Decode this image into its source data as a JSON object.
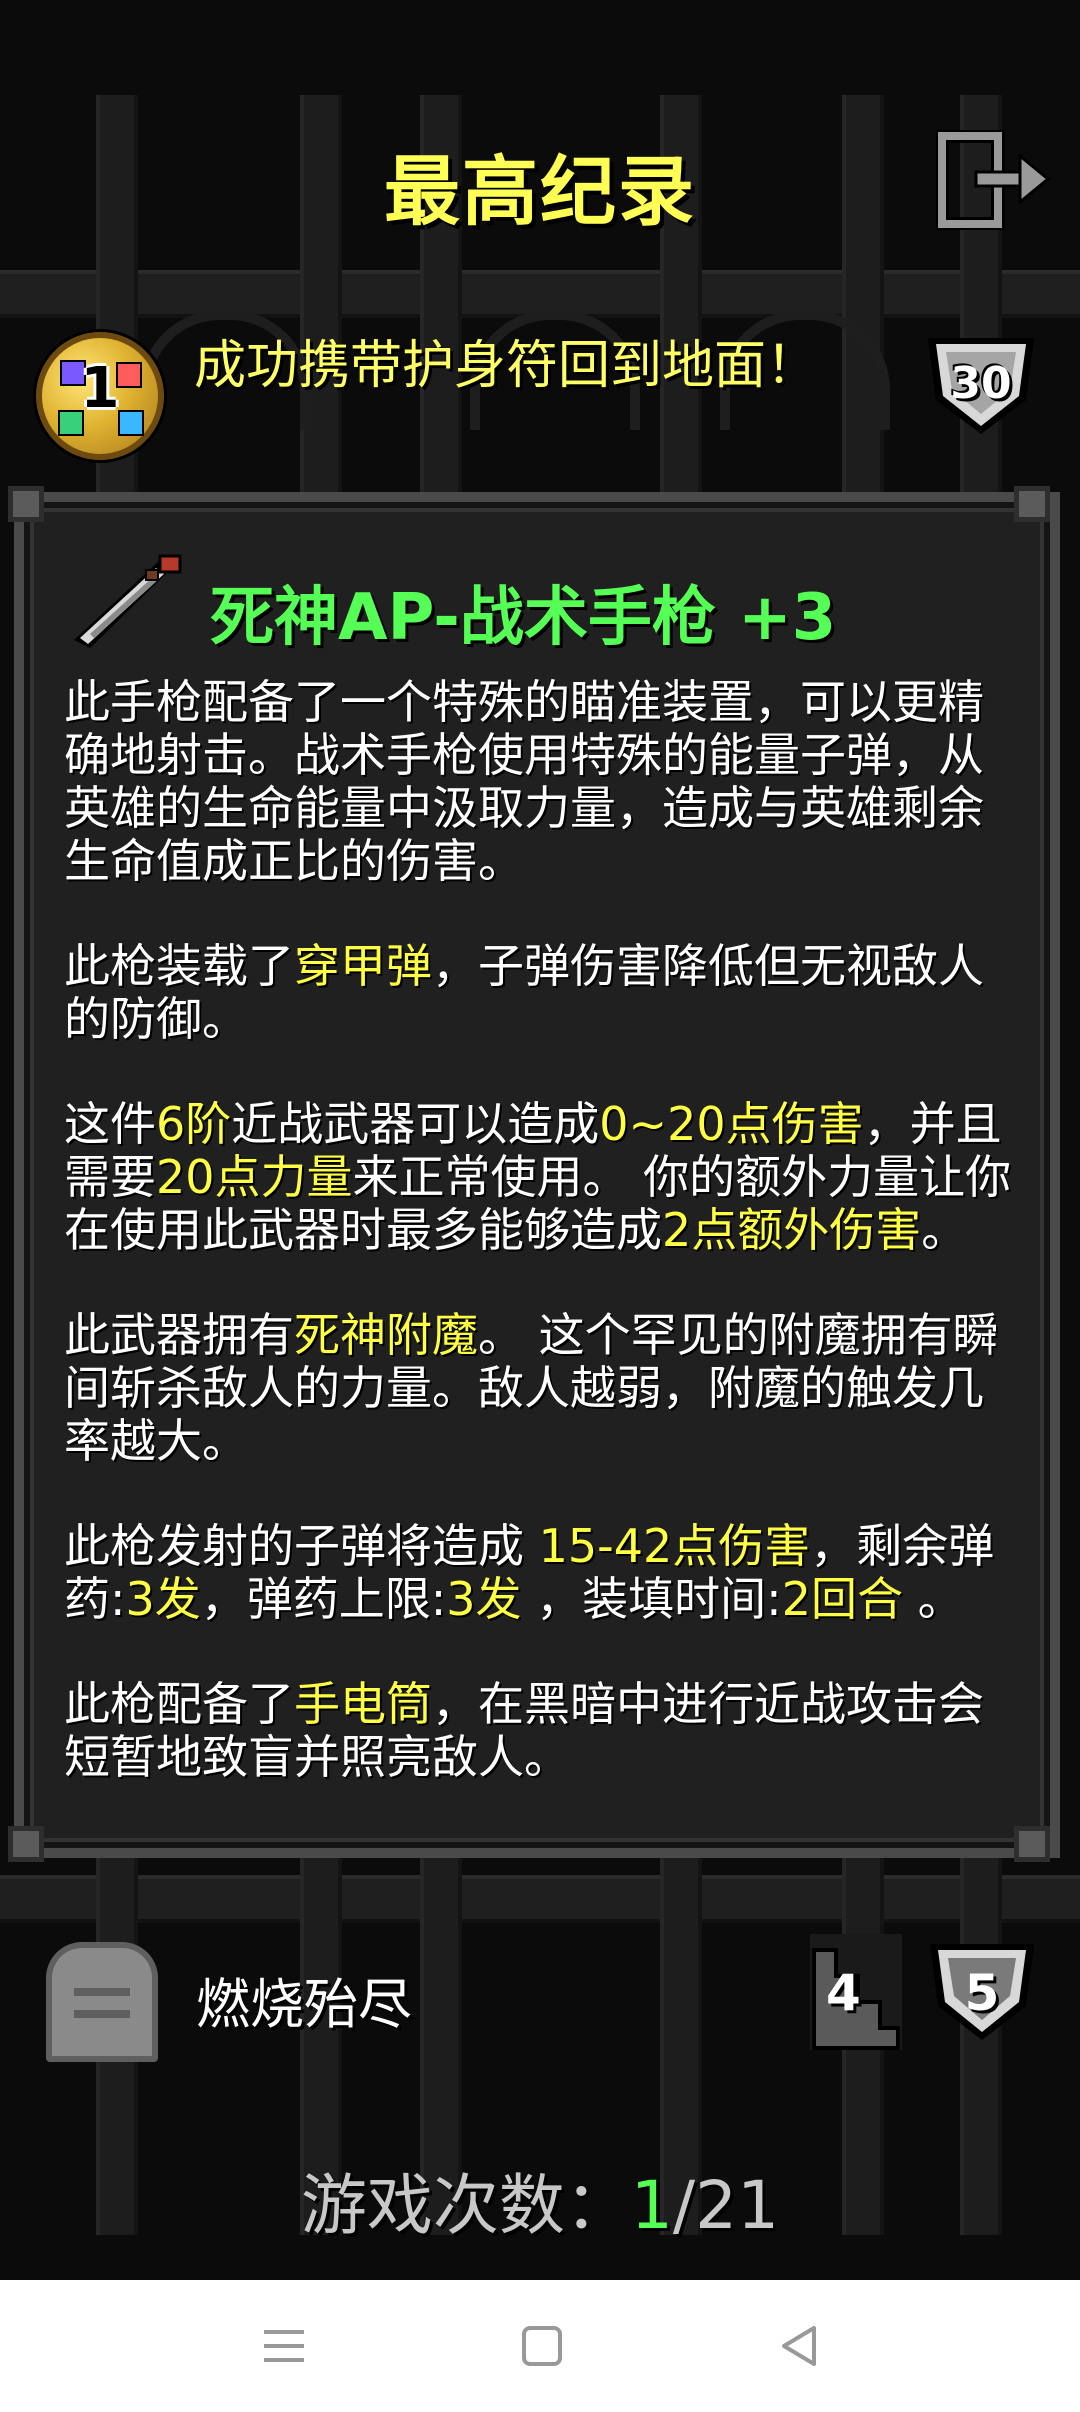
{
  "header": {
    "title": "最高纪录"
  },
  "record": {
    "rank": "1",
    "message": "成功携带护身符回到地面！",
    "score": "30"
  },
  "item": {
    "name": "死神AP-战术手枪 +3",
    "paragraphs": [
      [
        {
          "text": "此手枪配备了一个特殊的瞄准装置，可以更精确地射击。战术手枪使用特殊的能量子弹，从英雄的生命能量中汲取力量，造成与英雄剩余生命值成正比的伤害。",
          "hl": false
        }
      ],
      [
        {
          "text": "此枪装载了",
          "hl": false
        },
        {
          "text": "穿甲弹",
          "hl": true
        },
        {
          "text": "，子弹伤害降低但无视敌人的防御。",
          "hl": false
        }
      ],
      [
        {
          "text": "这件",
          "hl": false
        },
        {
          "text": "6阶",
          "hl": true
        },
        {
          "text": "近战武器可以造成",
          "hl": false
        },
        {
          "text": "0~20点伤害",
          "hl": true
        },
        {
          "text": "，并且需要",
          "hl": false
        },
        {
          "text": "20点力量",
          "hl": true
        },
        {
          "text": "来正常使用。 你的额外力量让你在使用此武器时最多能够造成",
          "hl": false
        },
        {
          "text": "2点额外伤害",
          "hl": true
        },
        {
          "text": "。",
          "hl": false
        }
      ],
      [
        {
          "text": "此武器拥有",
          "hl": false
        },
        {
          "text": "死神附魔",
          "hl": true
        },
        {
          "text": "。 这个罕见的附魔拥有瞬间斩杀敌人的力量。敌人越弱，附魔的触发几率越大。",
          "hl": false
        }
      ],
      [
        {
          "text": "此枪发射的子弹将造成 ",
          "hl": false
        },
        {
          "text": "15-42点伤害",
          "hl": true
        },
        {
          "text": "，剩余弹药:",
          "hl": false
        },
        {
          "text": "3发",
          "hl": true
        },
        {
          "text": "，弹药上限:",
          "hl": false
        },
        {
          "text": "3发",
          "hl": true
        },
        {
          "text": " ，装填时间:",
          "hl": false
        },
        {
          "text": "2回合",
          "hl": true
        },
        {
          "text": " 。",
          "hl": false
        }
      ],
      [
        {
          "text": "此枪配备了",
          "hl": false
        },
        {
          "text": "手电筒",
          "hl": true
        },
        {
          "text": "，在黑暗中进行近战攻击会短暂地致盲并照亮敌人。",
          "hl": false
        }
      ]
    ]
  },
  "death": {
    "cause": "燃烧殆尽",
    "depth": "4",
    "level": "5"
  },
  "games": {
    "label": "游戏次数：",
    "current": "1",
    "total": "/21"
  },
  "icons": {
    "exit": "exit-icon",
    "badge": "amulet-badge-icon",
    "score": "score-shield-icon",
    "weapon": "pistol-icon",
    "tomb": "tombstone-icon",
    "depth": "stairs-icon",
    "level": "level-shield-icon",
    "nav_menu": "menu-icon",
    "nav_home": "home-icon",
    "nav_back": "back-icon"
  },
  "colors": {
    "title": "#ffff55",
    "item_name": "#55ff55",
    "highlight": "#ffff44",
    "text": "#ffffff"
  }
}
